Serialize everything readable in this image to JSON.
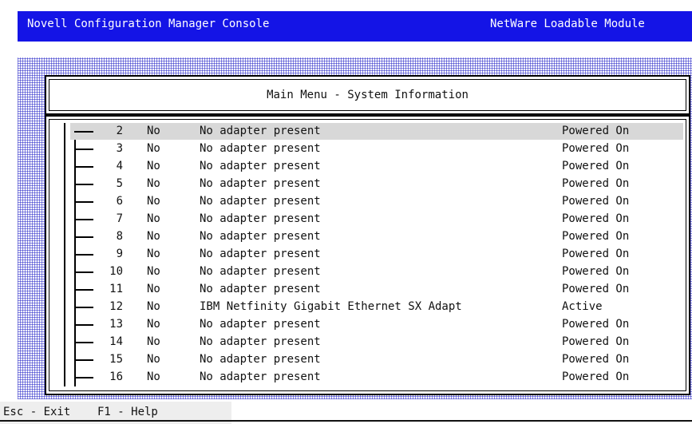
{
  "titlebar": {
    "left": "Novell Configuration Manager Console",
    "right": "NetWare Loadable Module"
  },
  "dialog": {
    "title": "Main Menu - System Information"
  },
  "rows": [
    {
      "num": "2",
      "yn": "No",
      "desc": "No adapter present",
      "status": "Powered On"
    },
    {
      "num": "3",
      "yn": "No",
      "desc": "No adapter present",
      "status": "Powered On"
    },
    {
      "num": "4",
      "yn": "No",
      "desc": "No adapter present",
      "status": "Powered On"
    },
    {
      "num": "5",
      "yn": "No",
      "desc": "No adapter present",
      "status": "Powered On"
    },
    {
      "num": "6",
      "yn": "No",
      "desc": "No adapter present",
      "status": "Powered On"
    },
    {
      "num": "7",
      "yn": "No",
      "desc": "No adapter present",
      "status": "Powered On"
    },
    {
      "num": "8",
      "yn": "No",
      "desc": "No adapter present",
      "status": "Powered On"
    },
    {
      "num": "9",
      "yn": "No",
      "desc": "No adapter present",
      "status": "Powered On"
    },
    {
      "num": "10",
      "yn": "No",
      "desc": "No adapter present",
      "status": "Powered On"
    },
    {
      "num": "11",
      "yn": "No",
      "desc": "No adapter present",
      "status": "Powered On"
    },
    {
      "num": "12",
      "yn": "No",
      "desc": "IBM Netfinity Gigabit Ethernet SX Adapt",
      "status": "Active"
    },
    {
      "num": "13",
      "yn": "No",
      "desc": "No adapter present",
      "status": "Powered On"
    },
    {
      "num": "14",
      "yn": "No",
      "desc": "No adapter present",
      "status": "Powered On"
    },
    {
      "num": "15",
      "yn": "No",
      "desc": "No adapter present",
      "status": "Powered On"
    },
    {
      "num": "16",
      "yn": "No",
      "desc": "No adapter present",
      "status": "Powered On"
    }
  ],
  "statusbar": {
    "text": "Esc - Exit    F1 - Help"
  },
  "colors": {
    "titlebar_bg": "#1414e6",
    "titlebar_fg": "#ffffff",
    "selection": "#d8d8d8"
  }
}
